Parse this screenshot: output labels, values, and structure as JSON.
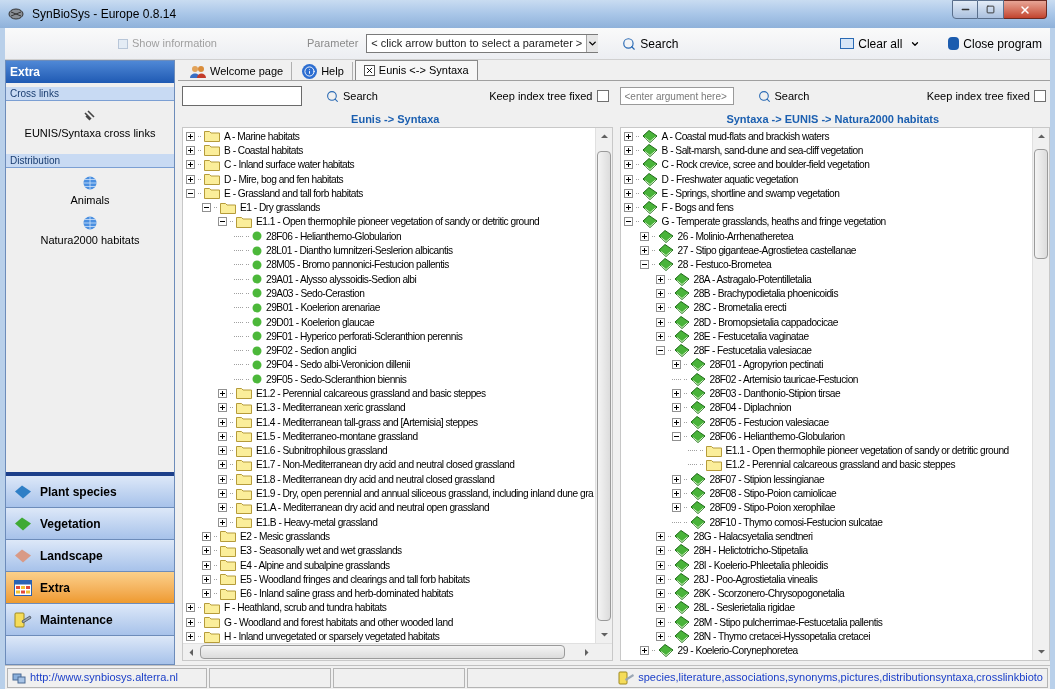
{
  "window": {
    "title": "SynBioSys - Europe 0.8.14"
  },
  "toolbar": {
    "show_information": {
      "label": "Show information",
      "disabled": true
    },
    "parameter_label": "Parameter",
    "parameter_select": {
      "value": "< click arrow button to select a parameter >"
    },
    "search_button": "Search",
    "clear_all": "Clear all",
    "close_program": "Close program"
  },
  "sidebar": {
    "title": "Extra",
    "sections": [
      {
        "title": "Cross links",
        "items": [
          {
            "kind": "link",
            "label": "EUNIS/Syntaxa cross links"
          }
        ]
      },
      {
        "title": "Distribution",
        "items": [
          {
            "kind": "globe",
            "label": "Animals"
          },
          {
            "kind": "globe",
            "label": "Natura2000 habitats"
          }
        ]
      }
    ],
    "nav": [
      {
        "label": "Plant species",
        "kind": "diamond",
        "color": "#2f7fc6",
        "selected": false
      },
      {
        "label": "Vegetation",
        "kind": "diamond",
        "color": "#3faa35",
        "selected": false
      },
      {
        "label": "Landscape",
        "kind": "diamond",
        "color": "#d99a86",
        "selected": false
      },
      {
        "label": "Extra",
        "kind": "grid",
        "selected": true
      },
      {
        "label": "Maintenance",
        "kind": "tools",
        "selected": false
      }
    ]
  },
  "tabs": [
    {
      "label": "Welcome page",
      "kind": "people",
      "selected": false
    },
    {
      "label": "Help",
      "kind": "help",
      "selected": false
    },
    {
      "label": "Eunis <-> Syntaxa",
      "kind": "closable",
      "selected": true
    }
  ],
  "left_panel": {
    "search_button": "Search",
    "keep_fixed": {
      "label": "Keep index tree fixed",
      "checked": false
    },
    "title": "Eunis -> Syntaxa",
    "tree": [
      {
        "kind": "folder",
        "label": "A - Marine habitats",
        "expanded": false
      },
      {
        "kind": "folder",
        "label": "B - Coastal habitats",
        "expanded": false
      },
      {
        "kind": "folder",
        "label": "C - Inland surface water habitats",
        "expanded": false
      },
      {
        "kind": "folder",
        "label": "D - Mire, bog and fen habitats",
        "expanded": false
      },
      {
        "kind": "folder",
        "label": "E - Grassland and tall forb habitats",
        "expanded": true,
        "children": [
          {
            "kind": "folder",
            "label": "E1 - Dry grasslands",
            "expanded": true,
            "children": [
              {
                "kind": "folder",
                "label": "E1.1 - Open thermophile pioneer vegetation of sandy or detritic ground",
                "expanded": true,
                "children": [
                  {
                    "kind": "dot",
                    "label": "28F06 - Helianthemo-Globularion"
                  },
                  {
                    "kind": "dot",
                    "label": "28L01 - Diantho lumnitzeri-Seslerion albicantis"
                  },
                  {
                    "kind": "dot",
                    "label": "28M05 - Bromo pannonici-Festucion pallentis"
                  },
                  {
                    "kind": "dot",
                    "label": "29A01 - Alysso alyssoidis-Sedion albi"
                  },
                  {
                    "kind": "dot",
                    "label": "29A03 - Sedo-Cerastion"
                  },
                  {
                    "kind": "dot",
                    "label": "29B01 - Koelerion arenariae"
                  },
                  {
                    "kind": "dot",
                    "label": "29D01 - Koelerion glaucae"
                  },
                  {
                    "kind": "dot",
                    "label": "29F01 - Hyperico perforati-Scleranthion perennis"
                  },
                  {
                    "kind": "dot",
                    "label": "29F02 - Sedion anglici"
                  },
                  {
                    "kind": "dot",
                    "label": "29F04 - Sedo albi-Veronicion dillenii"
                  },
                  {
                    "kind": "dot",
                    "label": "29F05 - Sedo-Scleranthion biennis"
                  }
                ]
              },
              {
                "kind": "folder",
                "label": "E1.2 - Perennial calcareous grassland and basic steppes",
                "expanded": false
              },
              {
                "kind": "folder",
                "label": "E1.3 - Mediterranean xeric grassland",
                "expanded": false
              },
              {
                "kind": "folder",
                "label": "E1.4 - Mediterranean tall-grass and [Artemisia] steppes",
                "expanded": false
              },
              {
                "kind": "folder",
                "label": "E1.5 - Mediterraneo-montane grassland",
                "expanded": false
              },
              {
                "kind": "folder",
                "label": "E1.6 - Subnitrophilous grassland",
                "expanded": false
              },
              {
                "kind": "folder",
                "label": "E1.7 - Non-Mediterranean dry acid and neutral closed grassland",
                "expanded": false
              },
              {
                "kind": "folder",
                "label": "E1.8 - Mediterranean dry acid and neutral closed grassland",
                "expanded": false
              },
              {
                "kind": "folder",
                "label": "E1.9 - Dry, open perennial and annual siliceous grassland, including inland dune gra",
                "expanded": false
              },
              {
                "kind": "folder",
                "label": "E1.A - Mediterranean dry acid and neutral open grassland",
                "expanded": false
              },
              {
                "kind": "folder",
                "label": "E1.B - Heavy-metal grassland",
                "expanded": false
              }
            ]
          },
          {
            "kind": "folder",
            "label": "E2 - Mesic grasslands",
            "expanded": false
          },
          {
            "kind": "folder",
            "label": "E3 - Seasonally wet and wet grasslands",
            "expanded": false
          },
          {
            "kind": "folder",
            "label": "E4 - Alpine and subalpine grasslands",
            "expanded": false
          },
          {
            "kind": "folder",
            "label": "E5 - Woodland fringes and clearings and tall forb habitats",
            "expanded": false
          },
          {
            "kind": "folder",
            "label": "E6 - Inland saline grass and herb-dominated habitats",
            "expanded": false
          }
        ]
      },
      {
        "kind": "folder",
        "label": "F - Heathland, scrub and tundra habitats",
        "expanded": false
      },
      {
        "kind": "folder",
        "label": "G - Woodland and forest habitats and other wooded land",
        "expanded": false
      },
      {
        "kind": "folder",
        "label": "H - Inland unvegetated or sparsely vegetated habitats",
        "expanded": false
      }
    ]
  },
  "right_panel": {
    "search_field": {
      "placeholder": "<enter argument here>"
    },
    "search_button": "Search",
    "keep_fixed": {
      "label": "Keep index tree fixed",
      "checked": false
    },
    "title": "Syntaxa -> EUNIS -> Natura2000  habitats",
    "tree": [
      {
        "kind": "book",
        "label": "A - Coastal mud-flats and brackish waters",
        "expanded": false
      },
      {
        "kind": "book",
        "label": "B - Salt-marsh, sand-dune and sea-cliff vegetation",
        "expanded": false
      },
      {
        "kind": "book",
        "label": "C - Rock crevice, scree and boulder-field vegetation",
        "expanded": false
      },
      {
        "kind": "book",
        "label": "D - Freshwater aquatic vegetation",
        "expanded": false
      },
      {
        "kind": "book",
        "label": "E - Springs, shortline and swamp vegetation",
        "expanded": false
      },
      {
        "kind": "book",
        "label": "F - Bogs and fens",
        "expanded": false
      },
      {
        "kind": "book",
        "label": "G - Temperate grasslands, heaths and fringe vegetation",
        "expanded": true,
        "children": [
          {
            "kind": "book",
            "label": "26 - Molinio-Arrhenatheretea",
            "expanded": false
          },
          {
            "kind": "book",
            "label": "27 - Stipo giganteae-Agrostietea castellanae",
            "expanded": false
          },
          {
            "kind": "book",
            "label": "28 - Festuco-Brometea",
            "expanded": true,
            "children": [
              {
                "kind": "book",
                "label": "28A - Astragalo-Potentilletalia",
                "expanded": false
              },
              {
                "kind": "book",
                "label": "28B - Brachypodietalia phoenicoidis",
                "expanded": false
              },
              {
                "kind": "book",
                "label": "28C - Brometalia erecti",
                "expanded": false
              },
              {
                "kind": "book",
                "label": "28D - Bromopsietalia cappadocicae",
                "expanded": false
              },
              {
                "kind": "book",
                "label": "28E - Festucetalia vaginatae",
                "expanded": false
              },
              {
                "kind": "book",
                "label": "28F - Festucetalia valesiacae",
                "expanded": true,
                "children": [
                  {
                    "kind": "book",
                    "label": "28F01 - Agropyrion pectinati",
                    "expanded": false
                  },
                  {
                    "kind": "book",
                    "label": "28F02 - Artemisio tauricae-Festucion"
                  },
                  {
                    "kind": "book",
                    "label": "28F03 - Danthonio-Stipion tirsae",
                    "expanded": false
                  },
                  {
                    "kind": "book",
                    "label": "28F04 - Diplachnion",
                    "expanded": false
                  },
                  {
                    "kind": "book",
                    "label": "28F05 - Festucion valesiacae",
                    "expanded": false
                  },
                  {
                    "kind": "book",
                    "label": "28F06 - Helianthemo-Globularion",
                    "expanded": true,
                    "children": [
                      {
                        "kind": "folder",
                        "label": "E1.1 - Open thermophile pioneer vegetation of sandy or detritic ground"
                      },
                      {
                        "kind": "folder",
                        "label": "E1.2 - Perennial calcareous grassland and basic steppes"
                      }
                    ]
                  },
                  {
                    "kind": "book",
                    "label": "28F07 - Stipion lessingianae",
                    "expanded": false
                  },
                  {
                    "kind": "book",
                    "label": "28F08 - Stipo-Poion carniolicae",
                    "expanded": false
                  },
                  {
                    "kind": "book",
                    "label": "28F09 - Stipo-Poion xerophilae",
                    "expanded": false
                  },
                  {
                    "kind": "book",
                    "label": "28F10 - Thymo comosi-Festucion sulcatae"
                  }
                ]
              },
              {
                "kind": "book",
                "label": "28G - Halacsyetalia sendtneri",
                "expanded": false
              },
              {
                "kind": "book",
                "label": "28H - Helictotricho-Stipetalia",
                "expanded": false
              },
              {
                "kind": "book",
                "label": "28I - Koelerio-Phleetalia phleoidis",
                "expanded": false
              },
              {
                "kind": "book",
                "label": "28J - Poo-Agrostietalia vinealis",
                "expanded": false
              },
              {
                "kind": "book",
                "label": "28K - Scorzonero-Chrysopogonetalia",
                "expanded": false
              },
              {
                "kind": "book",
                "label": "28L - Seslerietalia rigidae",
                "expanded": false
              },
              {
                "kind": "book",
                "label": "28M - Stipo pulcherrimae-Festucetalia pallentis",
                "expanded": false
              },
              {
                "kind": "book",
                "label": "28N - Thymo cretacei-Hyssopetalia cretacei",
                "expanded": false
              }
            ]
          },
          {
            "kind": "book",
            "label": "29 - Koelerio-Corynephoretea",
            "expanded": false
          }
        ]
      }
    ]
  },
  "status_bar": {
    "url": "http://www.synbiosys.alterra.nl",
    "info": "species,literature,associations,synonyms,pictures,distributionsyntaxa,crosslinkbioto"
  }
}
